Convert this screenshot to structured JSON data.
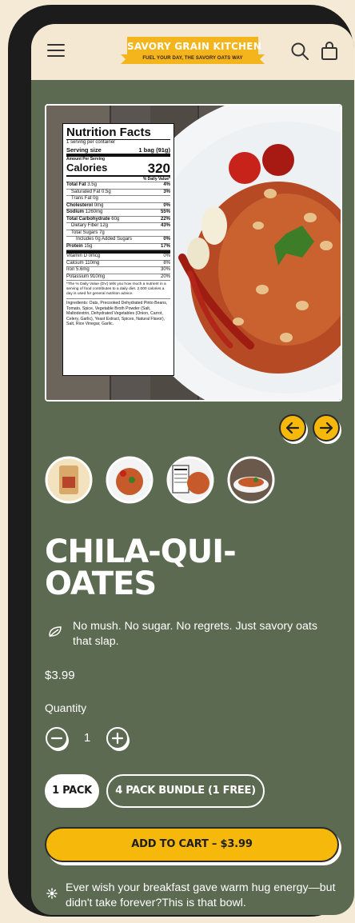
{
  "header": {
    "logo_title": "SAVORY GRAIN KITCHEN",
    "logo_tagline": "FUEL YOUR DAY, THE SAVORY OATS WAY",
    "menu_icon": "hamburger-menu-icon",
    "search_icon": "search-icon",
    "cart_icon": "shopping-bag-icon"
  },
  "nutrition": {
    "title": "Nutrition Facts",
    "servings": "1 serving per container",
    "serving_size_label": "Serving size",
    "serving_size_value": "1 bag (91g)",
    "amount_per_serving": "Amount Per Serving",
    "calories_label": "Calories",
    "calories_value": "320",
    "dv_header": "% Daily Value*",
    "rows": [
      {
        "label": "Total Fat",
        "amount": "3.5g",
        "dv": "4%",
        "style": "b"
      },
      {
        "label": "Saturated Fat",
        "amount": "0.5g",
        "dv": "3%",
        "style": "indent"
      },
      {
        "label": "Trans Fat",
        "amount": "0g",
        "dv": "",
        "style": "indent"
      },
      {
        "label": "Cholesterol",
        "amount": "0mg",
        "dv": "0%",
        "style": "b"
      },
      {
        "label": "Sodium",
        "amount": "1260mg",
        "dv": "55%",
        "style": "b"
      },
      {
        "label": "Total Carbohydrate",
        "amount": "60g",
        "dv": "22%",
        "style": "b"
      },
      {
        "label": "Dietary Fiber",
        "amount": "12g",
        "dv": "43%",
        "style": "indent"
      },
      {
        "label": "Total Sugars",
        "amount": "7g",
        "dv": "",
        "style": "indent"
      },
      {
        "label": "Includes 0g Added Sugars",
        "amount": "",
        "dv": "0%",
        "style": "indent2"
      },
      {
        "label": "Protein",
        "amount": "15g",
        "dv": "17%",
        "style": "b"
      }
    ],
    "vitamins": [
      {
        "label": "Vitamin D",
        "amount": "0mcg",
        "dv": "0%"
      },
      {
        "label": "Calcium",
        "amount": "110mg",
        "dv": "8%"
      },
      {
        "label": "Iron",
        "amount": "5.6mg",
        "dv": "30%"
      },
      {
        "label": "Potassium",
        "amount": "910mg",
        "dv": "20%"
      }
    ],
    "footnote": "*The % Daily Value (DV) tells you how much a nutrient in a serving of food contributes to a daily diet. 2,000 calories a day is used for general nutrition advice.",
    "ingredients": "Ingredients: Oats, Precooked Dehydrated Pinto Beans, Tomato, Spice, Vegetable Broth Powder (Salt, Maltodextrin, Dehydrated Vegetables (Onion, Carrot, Celery, Garlic), Yeast Extract, Spices, Natural Flavor), Salt, Rice Vinegar, Garlic."
  },
  "gallery": {
    "prev_icon": "arrow-left-icon",
    "next_icon": "arrow-right-icon",
    "thumbnails": [
      "product-bag-thumbnail",
      "chilaquiles-plate-thumbnail",
      "nutrition-label-thumbnail",
      "bowl-side-view-thumbnail"
    ]
  },
  "product": {
    "title_line1": "CHILA-QUI-",
    "title_line2": "OATES",
    "tagline": "No mush. No sugar. No regrets. Just savory oats that slap.",
    "tagline_icon": "leaf-icon",
    "price": "$3.99",
    "quantity_label": "Quantity",
    "quantity": "1",
    "minus_icon": "minus-circle-icon",
    "plus_icon": "plus-circle-icon",
    "options": [
      "1 PACK",
      "4 PACK BUNDLE (1 FREE)"
    ],
    "selected_option": "1 PACK",
    "add_to_cart": "ADD TO CART – $3.99",
    "promo": "Ever wish your breakfast gave warm hug energy—but didn't take forever?This is that bowl.",
    "promo_icon": "bowl-icon"
  },
  "colors": {
    "background": "#5b6a50",
    "header": "#f4e8d3",
    "accent": "#f7b80c",
    "logo_banner": "#f4b51c"
  }
}
